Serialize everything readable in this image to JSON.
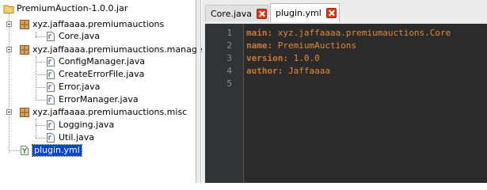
{
  "tree": {
    "root": {
      "label": "PremiumAuction-1.0.0.jar",
      "icon": "jar-folder-icon"
    },
    "packages": [
      {
        "label": "xyz.jaffaaaa.premiumauctions",
        "icon": "package-icon",
        "files": [
          "Core.java"
        ]
      },
      {
        "label": "xyz.jaffaaaa.premiumauctions.managers",
        "icon": "package-icon",
        "files": [
          "ConfigManager.java",
          "CreateErrorFile.java",
          "Error.java",
          "ErrorManager.java"
        ]
      },
      {
        "label": "xyz.jaffaaaa.premiumauctions.misc",
        "icon": "package-icon",
        "files": [
          "Logging.java",
          "Util.java"
        ]
      }
    ],
    "yml_file": {
      "label": "plugin.yml",
      "icon": "yaml-file-icon",
      "selected": true
    }
  },
  "tabs": [
    {
      "label": "Core.java",
      "active": false
    },
    {
      "label": "plugin.yml",
      "active": true
    }
  ],
  "editor": {
    "line_numbers": [
      "1",
      "2",
      "3",
      "4",
      "5"
    ],
    "lines": [
      {
        "key": "main",
        "sep": ": ",
        "value": "xyz.jaffaaaa.premiumauctions.Core"
      },
      {
        "key": "name",
        "sep": ": ",
        "value": "PremiumAuctions"
      },
      {
        "key": "version",
        "sep": ": ",
        "value": "1.0.0"
      },
      {
        "key": "author",
        "sep": ": ",
        "value": "Jaffaaaa"
      },
      {
        "key": "",
        "sep": "",
        "value": ""
      }
    ]
  },
  "colors": {
    "editor_bg": "#2b2b2b",
    "yaml_key": "#cc7832",
    "yaml_value": "#e08b33",
    "selection": "#0a46d6",
    "close_button": "#d9391f"
  }
}
